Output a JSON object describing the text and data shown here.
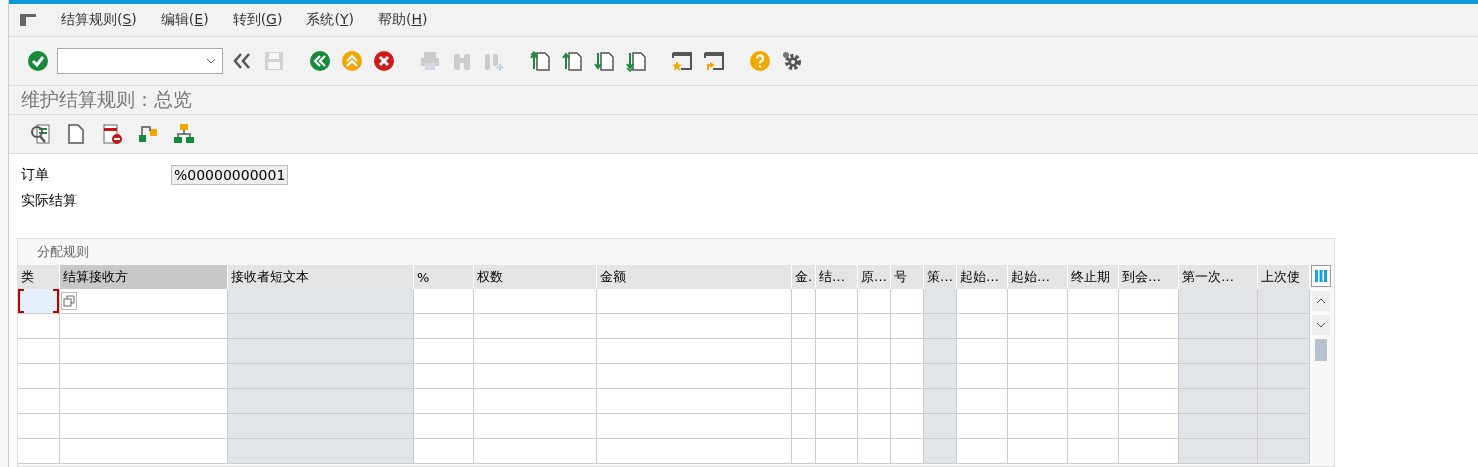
{
  "menu": [
    {
      "label": "结算规则(",
      "key": "S",
      "end": ")"
    },
    {
      "label": "编辑(",
      "key": "E",
      "end": ")"
    },
    {
      "label": "转到(",
      "key": "G",
      "end": ")"
    },
    {
      "label": "系统(",
      "key": "Y",
      "end": ")"
    },
    {
      "label": "帮助(",
      "key": "H",
      "end": ")"
    }
  ],
  "toolbar": [
    {
      "kind": "check",
      "disabled": false
    },
    {
      "kind": "field"
    },
    {
      "kind": "chevrons",
      "disabled": false
    },
    {
      "kind": "save",
      "disabled": true
    },
    {
      "kind": "gap"
    },
    {
      "kind": "back",
      "disabled": false
    },
    {
      "kind": "exit",
      "disabled": false
    },
    {
      "kind": "cancel",
      "disabled": false
    },
    {
      "kind": "gap"
    },
    {
      "kind": "print",
      "disabled": true
    },
    {
      "kind": "find",
      "disabled": true
    },
    {
      "kind": "findnext",
      "disabled": true
    },
    {
      "kind": "gap"
    },
    {
      "kind": "firstpage",
      "disabled": false
    },
    {
      "kind": "prevpage",
      "disabled": false
    },
    {
      "kind": "nextpage",
      "disabled": false
    },
    {
      "kind": "lastpage",
      "disabled": false
    },
    {
      "kind": "gap"
    },
    {
      "kind": "bookmark",
      "disabled": false
    },
    {
      "kind": "shortcut",
      "disabled": false
    },
    {
      "kind": "gap"
    },
    {
      "kind": "help",
      "disabled": false
    },
    {
      "kind": "settings",
      "disabled": false
    }
  ],
  "title": "维护结算规则：总览",
  "app_toolbar": [
    {
      "kind": "detail"
    },
    {
      "kind": "new"
    },
    {
      "kind": "delete"
    },
    {
      "kind": "hierarchy"
    },
    {
      "kind": "tree"
    }
  ],
  "fields": [
    {
      "label": "订单",
      "value": "%00000000001"
    },
    {
      "label": "实际结算"
    }
  ],
  "table": {
    "title": "分配规则",
    "columns": [
      {
        "label": "类",
        "readonly": false,
        "selected": false
      },
      {
        "label": "结算接收方",
        "readonly": false,
        "selected": true
      },
      {
        "label": "接收者短文本",
        "readonly": true,
        "selected": false
      },
      {
        "label": "%",
        "readonly": false,
        "selected": false
      },
      {
        "label": "权数",
        "readonly": false,
        "selected": false
      },
      {
        "label": "金额",
        "readonly": false,
        "selected": false
      },
      {
        "label": "金.",
        "readonly": false,
        "selected": false
      },
      {
        "label": "结…",
        "readonly": false,
        "selected": false
      },
      {
        "label": "原…",
        "readonly": false,
        "selected": false
      },
      {
        "label": "号",
        "readonly": false,
        "selected": false
      },
      {
        "label": "策…",
        "readonly": true,
        "selected": false
      },
      {
        "label": "起始…",
        "readonly": false,
        "selected": false
      },
      {
        "label": "起始…",
        "readonly": false,
        "selected": false
      },
      {
        "label": "终止期",
        "readonly": false,
        "selected": false
      },
      {
        "label": "到会…",
        "readonly": false,
        "selected": false
      },
      {
        "label": "第一次…",
        "readonly": true,
        "selected": false
      },
      {
        "label": "上次使",
        "readonly": true,
        "selected": false
      }
    ],
    "rows": [
      {
        "focused": true
      },
      {
        "focused": false
      },
      {
        "focused": false
      },
      {
        "focused": false
      },
      {
        "focused": false
      },
      {
        "focused": false
      },
      {
        "focused": false
      }
    ]
  }
}
